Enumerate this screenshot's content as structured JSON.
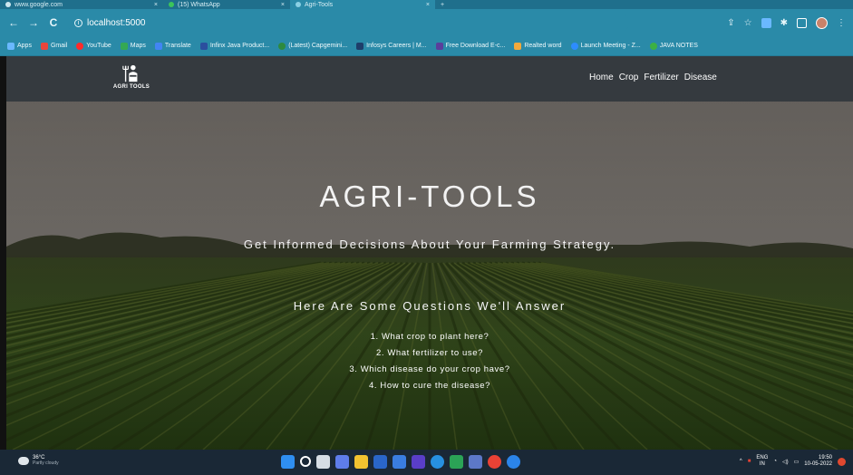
{
  "browser": {
    "tabs": [
      {
        "title": "www.google.com",
        "close": "×"
      },
      {
        "title": "(15) WhatsApp",
        "close": "×"
      },
      {
        "title": "Agri-Tools",
        "close": "×"
      }
    ],
    "new_tab": "+",
    "address": "localhost:5000",
    "nav": {
      "back": "←",
      "forward": "→",
      "reload": "C"
    },
    "bookmarks": [
      {
        "label": "Apps",
        "color": "#6ab8ff"
      },
      {
        "label": "Gmail",
        "color": "#e8453c"
      },
      {
        "label": "YouTube",
        "color": "#ff2a2a"
      },
      {
        "label": "Maps",
        "color": "#34a853"
      },
      {
        "label": "Translate",
        "color": "#4285f4"
      },
      {
        "label": "Infinx Java Product...",
        "color": "#2b4f9e"
      },
      {
        "label": "(Latest) Capgemini...",
        "color": "#2d8a3e"
      },
      {
        "label": "Infosys Careers | M...",
        "color": "#1e3e6a"
      },
      {
        "label": "Free Download E-c...",
        "color": "#5a3e9b"
      },
      {
        "label": "Realted word",
        "color": "#f2a93b"
      },
      {
        "label": "Launch Meeting - Z...",
        "color": "#2d8cff"
      },
      {
        "label": "JAVA NOTES",
        "color": "#3cb043"
      }
    ]
  },
  "site": {
    "logo_text": "AGRI TOOLS",
    "nav": [
      "Home",
      "Crop",
      "Fertilizer",
      "Disease"
    ],
    "hero": {
      "title": "AGRI-TOOLS",
      "subtitle": "Get Informed Decisions About Your Farming Strategy.",
      "questions_heading": "Here Are Some Questions We'll Answer",
      "questions": [
        "1. What crop to plant here?",
        "2. What fertilizer to use?",
        "3. Which disease do your crop have?",
        "4. How to cure the disease?"
      ]
    }
  },
  "taskbar": {
    "weather": {
      "temp": "36°C",
      "desc": "Partly cloudy"
    },
    "lang": {
      "top": "ENG",
      "bottom": "IN"
    },
    "clock": {
      "time": "19:50",
      "date": "10-05-2022"
    }
  }
}
